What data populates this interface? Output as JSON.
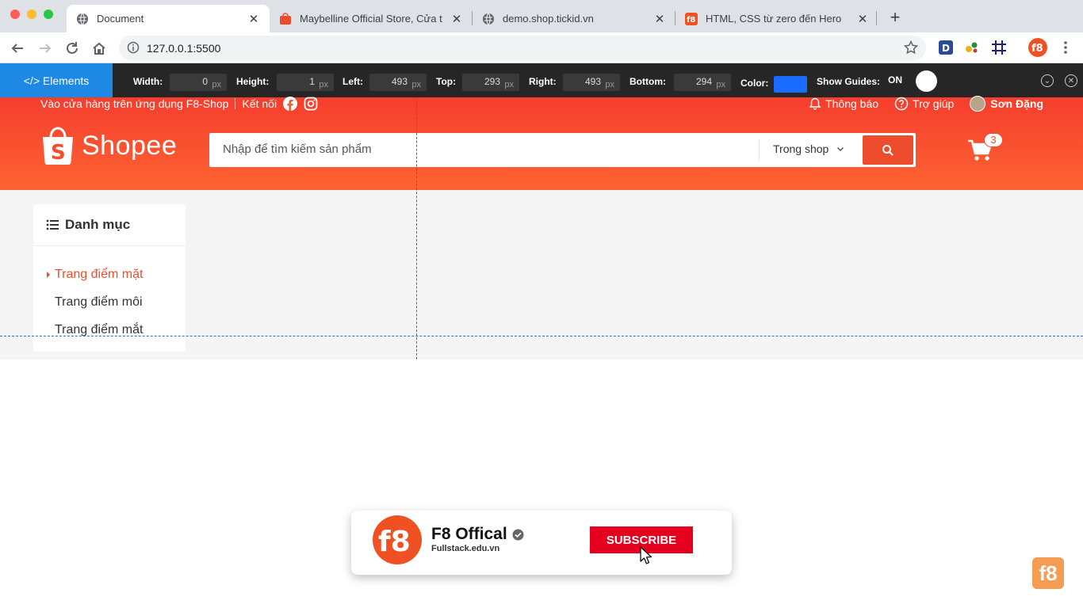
{
  "browser": {
    "tabs": [
      {
        "title": "Document",
        "icon": "globe-icon",
        "active": true
      },
      {
        "title": "Maybelline Official Store, Cửa t",
        "icon": "shopee-favicon-icon",
        "active": false
      },
      {
        "title": "demo.shop.tickid.vn",
        "icon": "globe-icon",
        "active": false
      },
      {
        "title": "HTML, CSS từ zero đến Hero",
        "icon": "f8-favicon-icon",
        "active": false
      }
    ],
    "url": "127.0.0.1:5500"
  },
  "elements_bar": {
    "tab_label": "</> Elements",
    "width_label": "Width:",
    "width_value": "0",
    "height_label": "Height:",
    "height_value": "1",
    "left_label": "Left:",
    "left_value": "493",
    "top_label": "Top:",
    "top_value": "293",
    "right_label": "Right:",
    "right_value": "493",
    "bottom_label": "Bottom:",
    "bottom_value": "294",
    "unit": "px",
    "color_label": "Color:",
    "color_value": "#1a6bff",
    "guides_label": "Show Guides:",
    "guides_state": "ON"
  },
  "shopee": {
    "top_left_text": "Vào cửa hàng trên ứng dụng F8-Shop",
    "connect_text": "Kết nối",
    "notifications": "Thông báo",
    "help": "Trợ giúp",
    "user_name": "Sơn Đặng",
    "logo_text": "Shopee",
    "search_placeholder": "Nhập để tìm kiếm sản phẩm",
    "search_scope": "Trong shop",
    "cart_count": "3",
    "brand_color": "#ee4d2d"
  },
  "category": {
    "title": "Danh mục",
    "items": [
      {
        "label": "Trang điểm mặt",
        "active": true
      },
      {
        "label": "Trang điểm môi",
        "active": false
      },
      {
        "label": "Trang điểm mắt",
        "active": false
      }
    ]
  },
  "subscribe": {
    "channel": "F8 Offical",
    "site": "Fullstack.edu.vn",
    "button": "SUBSCRIBE"
  },
  "corner_logo": "f8"
}
